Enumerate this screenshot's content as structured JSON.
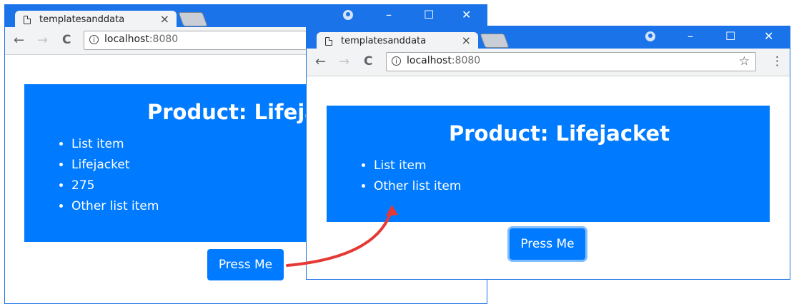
{
  "window_before": {
    "tab_title": "templatesanddata",
    "tab_close": "×",
    "url_host": "localhost",
    "url_port": ":8080",
    "product_title": "Product: Lifejacket",
    "list_items": [
      "List item",
      "Lifejacket",
      "275",
      "Other list item"
    ],
    "button_label": "Press Me"
  },
  "window_after": {
    "tab_title": "templatesanddata",
    "tab_close": "×",
    "url_host": "localhost",
    "url_port": ":8080",
    "product_title": "Product: Lifejacket",
    "list_items": [
      "List item",
      "Other list item"
    ],
    "button_label": "Press Me"
  },
  "controls": {
    "back": "←",
    "forward": "→",
    "reload": "C",
    "info": "i",
    "star": "☆",
    "menu": "⋮",
    "minimize": "–",
    "maximize": "☐",
    "close": "✕"
  },
  "colors": {
    "titlebar": "#1a73e8",
    "primary": "#007bff",
    "arrow": "#e53935"
  }
}
